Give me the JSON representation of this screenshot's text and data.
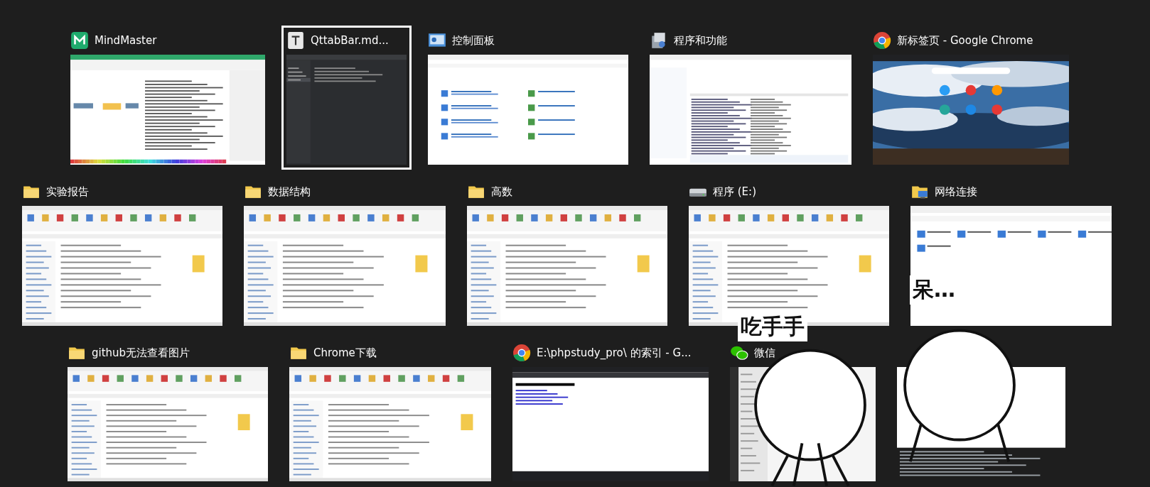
{
  "rows": [
    {
      "windows": [
        {
          "title": "MindMaster",
          "kind": "mindmaster",
          "selected": false
        },
        {
          "title": "QttabBar.md...",
          "kind": "text-file",
          "selected": true
        },
        {
          "title": "控制面板",
          "kind": "control-panel",
          "selected": false
        },
        {
          "title": "程序和功能",
          "kind": "programs",
          "selected": false
        },
        {
          "title": "新标签页 - Google Chrome",
          "kind": "chrome",
          "selected": false
        }
      ]
    },
    {
      "windows": [
        {
          "title": "实验报告",
          "kind": "folder",
          "selected": false
        },
        {
          "title": "数据结构",
          "kind": "folder",
          "selected": false
        },
        {
          "title": "高数",
          "kind": "folder",
          "selected": false
        },
        {
          "title": "程序 (E:)",
          "kind": "drive",
          "selected": false
        },
        {
          "title": "网络连接",
          "kind": "network",
          "selected": false
        }
      ]
    },
    {
      "windows": [
        {
          "title": "github无法查看图片",
          "kind": "folder",
          "selected": false
        },
        {
          "title": "Chrome下载",
          "kind": "folder",
          "selected": false
        },
        {
          "title": "E:\\phpstudy_pro\\ 的索引 - G...",
          "kind": "chrome",
          "selected": false
        },
        {
          "title": "微信",
          "kind": "wechat",
          "selected": false
        },
        {
          "kind": "window",
          "selected": false
        }
      ]
    }
  ],
  "stickers": [
    {
      "caption": "吃手手"
    },
    {
      "caption": "呆…"
    }
  ]
}
